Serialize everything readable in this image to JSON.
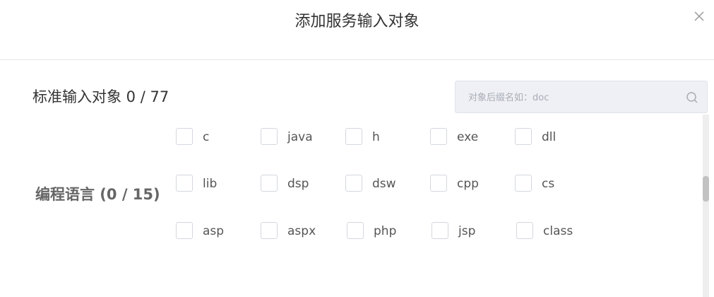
{
  "dialog": {
    "title": "添加服务输入对象",
    "close_icon": "close-icon"
  },
  "section": {
    "title": "标准输入对象 0 / 77"
  },
  "search": {
    "placeholder": "对象后缀名如：doc",
    "value": "",
    "icon": "search-icon"
  },
  "group": {
    "label": "编程语言 (0 / 15)",
    "options": [
      {
        "label": "c",
        "checked": false
      },
      {
        "label": "java",
        "checked": false
      },
      {
        "label": "h",
        "checked": false
      },
      {
        "label": "exe",
        "checked": false
      },
      {
        "label": "dll",
        "checked": false
      },
      {
        "label": "lib",
        "checked": false
      },
      {
        "label": "dsp",
        "checked": false
      },
      {
        "label": "dsw",
        "checked": false
      },
      {
        "label": "cpp",
        "checked": false
      },
      {
        "label": "cs",
        "checked": false
      },
      {
        "label": "asp",
        "checked": false
      },
      {
        "label": "aspx",
        "checked": false
      },
      {
        "label": "php",
        "checked": false
      },
      {
        "label": "jsp",
        "checked": false
      },
      {
        "label": "class",
        "checked": false
      }
    ]
  }
}
